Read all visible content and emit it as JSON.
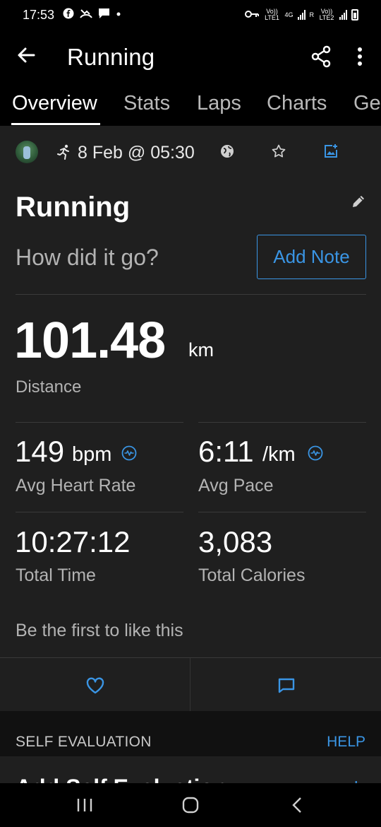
{
  "status_bar": {
    "time": "17:53",
    "network_labels": [
      "Vo)) LTE1",
      "4G",
      "R",
      "Vo)) LTE2"
    ]
  },
  "app_bar": {
    "title": "Running",
    "back_icon": "arrow-left-icon",
    "share_icon": "share-icon",
    "more_icon": "more-vertical-icon"
  },
  "tabs": [
    {
      "label": "Overview",
      "active": true
    },
    {
      "label": "Stats",
      "active": false
    },
    {
      "label": "Laps",
      "active": false
    },
    {
      "label": "Charts",
      "active": false
    },
    {
      "label": "Ge",
      "active": false
    }
  ],
  "activity": {
    "date": "8 Feb @ 05:30",
    "title": "Running",
    "prompt": "How did it go?",
    "add_note_label": "Add Note"
  },
  "stats": {
    "distance": {
      "value": "101.48",
      "unit": "km",
      "label": "Distance"
    },
    "heart_rate": {
      "value": "149",
      "unit": "bpm",
      "label": "Avg Heart Rate"
    },
    "pace": {
      "value": "6:11",
      "unit": "/km",
      "label": "Avg Pace"
    },
    "total_time": {
      "value": "10:27:12",
      "label": "Total Time"
    },
    "calories": {
      "value": "3,083",
      "label": "Total Calories"
    }
  },
  "social": {
    "likes_text": "Be the first to like this"
  },
  "self_evaluation": {
    "header": "SELF EVALUATION",
    "help_label": "HELP",
    "add_label": "Add Self Evaluation",
    "add_icon": "+"
  },
  "colors": {
    "accent": "#3a95e4",
    "background": "#1f1f1f",
    "app_bar": "#000000",
    "secondary_text": "#b3b3b3"
  }
}
